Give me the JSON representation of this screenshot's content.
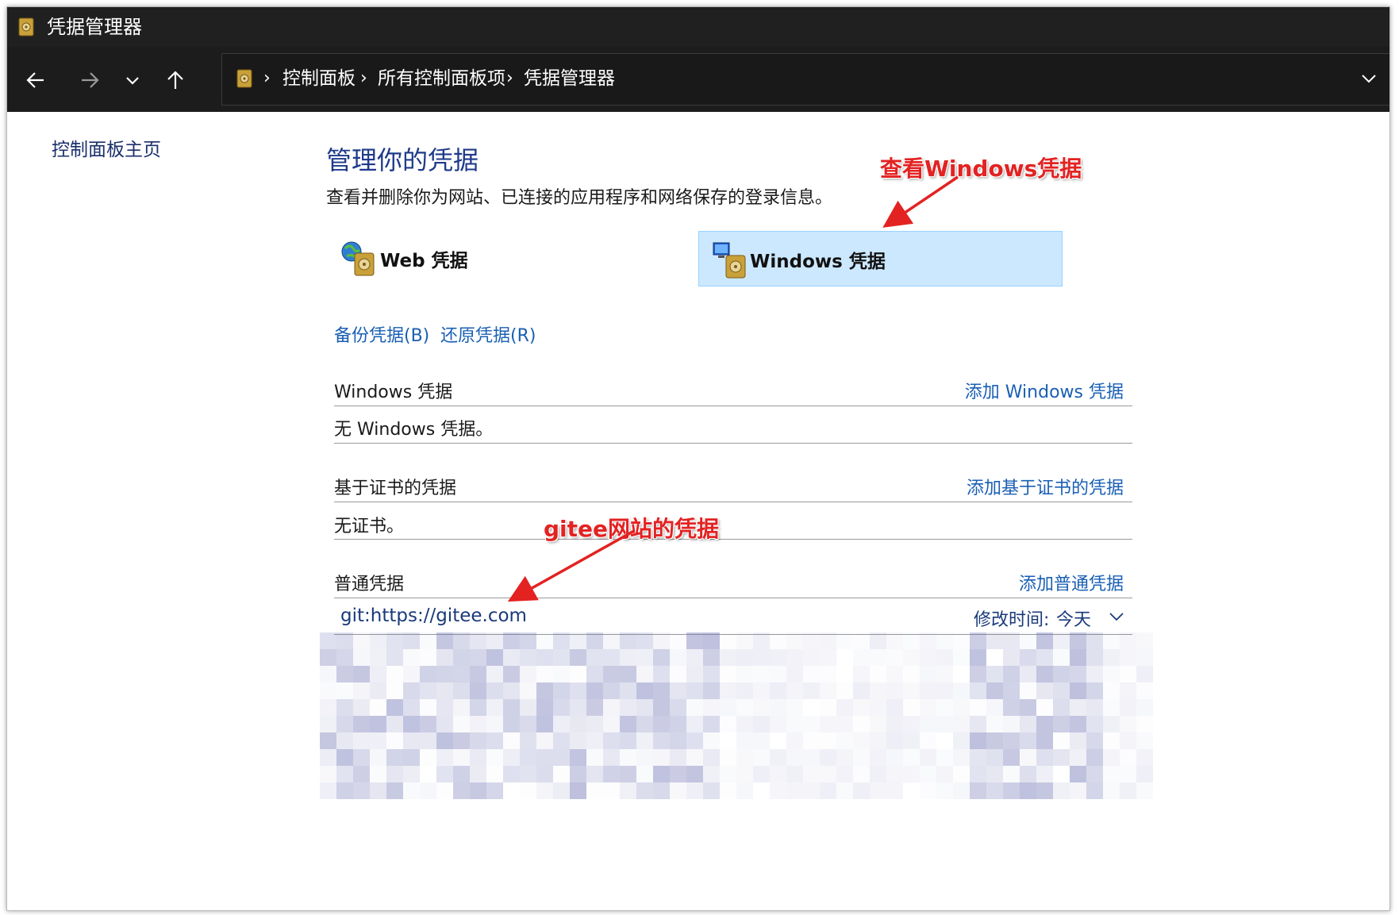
{
  "window": {
    "title": "凭据管理器"
  },
  "navigation": {
    "back_icon": "arrow-left-icon",
    "forward_icon": "arrow-right-icon",
    "recent_icon": "chevron-down-icon",
    "up_icon": "arrow-up-icon",
    "breadcrumbs": [
      "控制面板",
      "所有控制面板项",
      "凭据管理器"
    ],
    "separator": "›"
  },
  "sidebar": {
    "home_link": "控制面板主页"
  },
  "main": {
    "heading": "管理你的凭据",
    "description": "查看并删除你为网站、已连接的应用程序和网络保存的登录信息。",
    "categories": [
      {
        "label": "Web 凭据",
        "icon": "web-credential-icon",
        "selected": false
      },
      {
        "label": "Windows 凭据",
        "icon": "windows-credential-icon",
        "selected": true
      }
    ],
    "actions": {
      "backup": "备份凭据(B)",
      "restore": "还原凭据(R)"
    },
    "sections": {
      "windows": {
        "title": "Windows 凭据",
        "add_link": "添加 Windows 凭据",
        "empty_text": "无 Windows 凭据。"
      },
      "certificate": {
        "title": "基于证书的凭据",
        "add_link": "添加基于证书的凭据",
        "empty_text": "无证书。"
      },
      "generic": {
        "title": "普通凭据",
        "add_link": "添加普通凭据",
        "items": [
          {
            "name": "git:https://gitee.com",
            "modified_label": "修改时间:",
            "modified_value": "今天"
          }
        ]
      }
    }
  },
  "annotations": {
    "windows_note": "查看Windows凭据",
    "gitee_note": "gitee网站的凭据"
  },
  "colors": {
    "accent_red": "#e32222",
    "link_blue": "#1a5fb4",
    "selection": "#cce8ff",
    "titlebar": "#202020"
  }
}
